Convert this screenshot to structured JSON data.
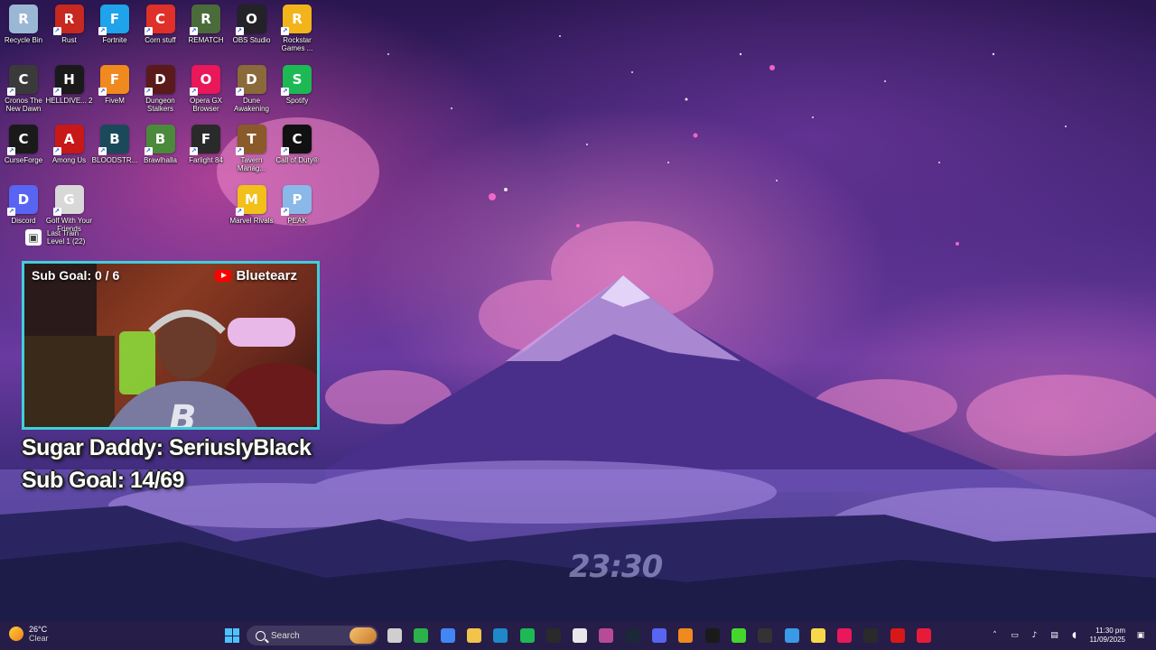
{
  "desktop": {
    "icons": [
      {
        "label": "Recycle Bin",
        "icon": "recycle-bin-icon",
        "color": "#9ab7d6"
      },
      {
        "label": "Rust",
        "icon": "rust-icon",
        "color": "#c7281f"
      },
      {
        "label": "Fortnite",
        "icon": "fortnite-icon",
        "color": "#1fa3ea"
      },
      {
        "label": "Corn stuff",
        "icon": "corn-stuff-icon",
        "color": "#e0302a"
      },
      {
        "label": "REMATCH",
        "icon": "rematch-icon",
        "color": "#4a6b3a"
      },
      {
        "label": "OBS Studio",
        "icon": "obs-studio-icon",
        "color": "#222228"
      },
      {
        "label": "Rockstar Games ...",
        "icon": "rockstar-games-icon",
        "color": "#f2b41a"
      },
      {
        "label": "Cronos The New Dawn",
        "icon": "cronos-icon",
        "color": "#3a3a3a"
      },
      {
        "label": "HELLDIVE... 2",
        "icon": "helldivers-icon",
        "color": "#1a1a1a"
      },
      {
        "label": "FiveM",
        "icon": "fivem-icon",
        "color": "#f08a1e"
      },
      {
        "label": "Dungeon Stalkers",
        "icon": "dungeon-stalkers-icon",
        "color": "#5a1a1a"
      },
      {
        "label": "Opera GX Browser",
        "icon": "opera-gx-icon",
        "color": "#e8185a"
      },
      {
        "label": "Dune Awakening",
        "icon": "dune-awakening-icon",
        "color": "#8a6a3a"
      },
      {
        "label": "Spotify",
        "icon": "spotify-icon",
        "color": "#1db954"
      },
      {
        "label": "CurseForge",
        "icon": "curseforge-icon",
        "color": "#1a1a1a"
      },
      {
        "label": "Among Us",
        "icon": "among-us-icon",
        "color": "#c81818"
      },
      {
        "label": "BLOODSTR...",
        "icon": "bloodstrike-icon",
        "color": "#1a4a5a"
      },
      {
        "label": "Brawlhalla",
        "icon": "brawlhalla-icon",
        "color": "#4a8a3a"
      },
      {
        "label": "Farlight 84",
        "icon": "farlight-icon",
        "color": "#2a2a2a"
      },
      {
        "label": "Tavern Manag...",
        "icon": "tavern-manager-icon",
        "color": "#8a5a2a"
      },
      {
        "label": "Call of Duty®",
        "icon": "call-of-duty-icon",
        "color": "#111111"
      },
      {
        "label": "Discord",
        "icon": "discord-icon",
        "color": "#5865f2"
      },
      {
        "label": "Golf With Your Friends",
        "icon": "golf-with-friends-icon",
        "color": "#d8d8d8"
      },
      {
        "label": "Marvel Rivals",
        "icon": "marvel-rivals-icon",
        "color": "#f2c01a"
      },
      {
        "label": "PEAK",
        "icon": "peak-icon",
        "color": "#8ab8e8"
      }
    ],
    "last_train": {
      "line1": "Last Train",
      "line2": "Level 1  (22)"
    }
  },
  "overlay": {
    "cam_subgoal": "Sub Goal:  0 / 6",
    "channel": "Bluetearz",
    "sugar_daddy": "Sugar Daddy: SeriuslyBlack",
    "sub_goal": "Sub Goal: 14/69"
  },
  "clock_widget": "23:30",
  "taskbar": {
    "weather_temp": "26°C",
    "weather_desc": "Clear",
    "search_placeholder": "Search",
    "apps": [
      {
        "icon": "start-icon"
      },
      {
        "icon": "task-view-icon",
        "color": "#cfcfcf"
      },
      {
        "icon": "xbox-icon",
        "color": "#2bb24a"
      },
      {
        "icon": "chrome-icon",
        "color": "#4285f4"
      },
      {
        "icon": "file-explorer-icon",
        "color": "#f2c44a"
      },
      {
        "icon": "vscode-icon",
        "color": "#1e88c8"
      },
      {
        "icon": "spotify-icon",
        "color": "#1db954"
      },
      {
        "icon": "epic-games-icon",
        "color": "#2a2a2a"
      },
      {
        "icon": "notepad-icon",
        "color": "#e8e8e8"
      },
      {
        "icon": "game-icon",
        "color": "#b84a9a"
      },
      {
        "icon": "steam-icon",
        "color": "#1b2838"
      },
      {
        "icon": "discord-icon",
        "color": "#5865f2"
      },
      {
        "icon": "vlc-icon",
        "color": "#f08a1e"
      },
      {
        "icon": "capcut-icon",
        "color": "#1a1a1a"
      },
      {
        "icon": "razer-icon",
        "color": "#44d62c"
      },
      {
        "icon": "obs-icon",
        "color": "#333333"
      },
      {
        "icon": "photos-icon",
        "color": "#3a9ae8"
      },
      {
        "icon": "sticky-notes-icon",
        "color": "#f8d84a"
      },
      {
        "icon": "opera-gx-icon",
        "color": "#e8185a"
      },
      {
        "icon": "terminal-icon",
        "color": "#2a2a2a"
      },
      {
        "icon": "red-app-icon",
        "color": "#d81818"
      },
      {
        "icon": "tiktok-live-icon",
        "color": "#e81a3a"
      }
    ],
    "time": "11:30 pm",
    "date": "11/09/2025"
  }
}
